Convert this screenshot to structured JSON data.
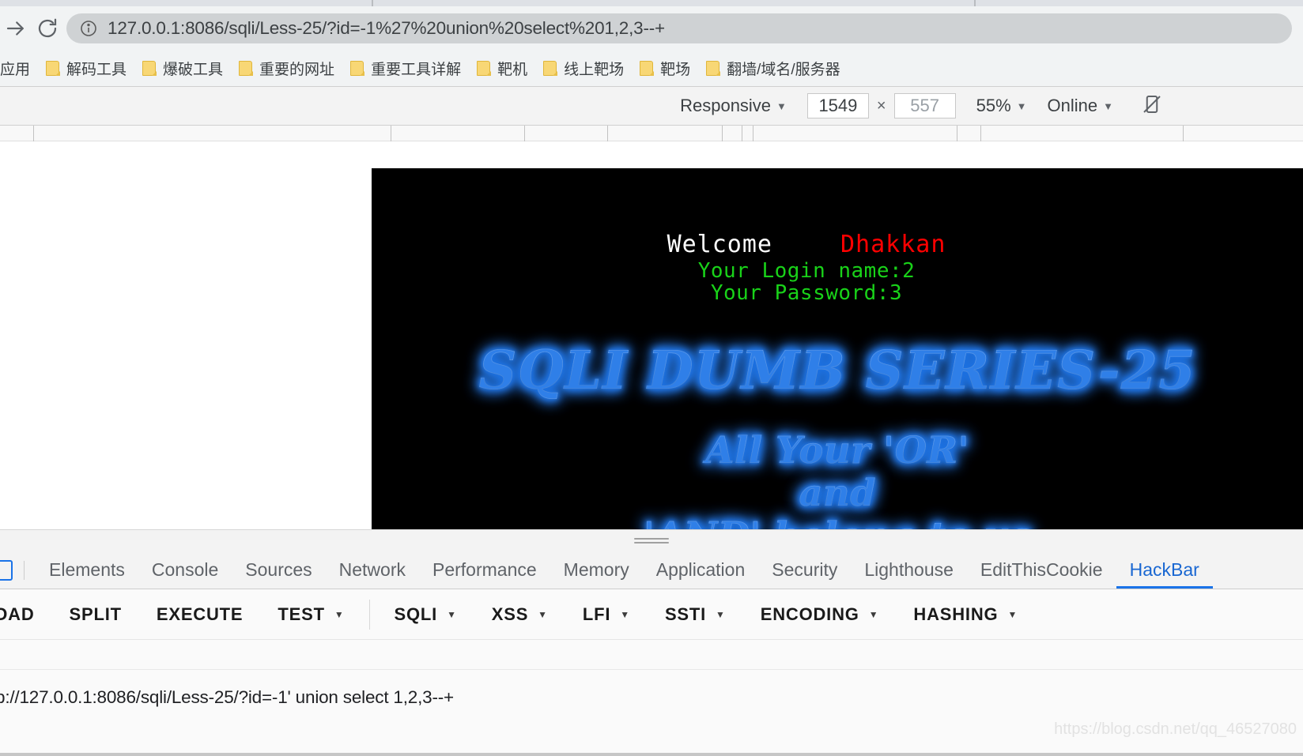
{
  "browser": {
    "nav": {
      "forward_icon": "arrow-right-icon",
      "reload_icon": "reload-icon"
    },
    "omnibox": {
      "info_icon": "info-circle-icon",
      "url": "127.0.0.1:8086/sqli/Less-25/?id=-1%27%20union%20select%201,2,3--+"
    },
    "bookmarks": [
      {
        "label": "应用",
        "icon": "apps-icon",
        "has_folder": false
      },
      {
        "label": "解码工具",
        "icon": "folder-icon",
        "has_folder": true
      },
      {
        "label": "爆破工具",
        "icon": "folder-icon",
        "has_folder": true
      },
      {
        "label": "重要的网址",
        "icon": "folder-icon",
        "has_folder": true
      },
      {
        "label": "重要工具详解",
        "icon": "folder-icon",
        "has_folder": true
      },
      {
        "label": "靶机",
        "icon": "folder-icon",
        "has_folder": true
      },
      {
        "label": "线上靶场",
        "icon": "folder-icon",
        "has_folder": true
      },
      {
        "label": "靶场",
        "icon": "folder-icon",
        "has_folder": true
      },
      {
        "label": "翻墙/域名/服务器",
        "icon": "folder-icon",
        "has_folder": true
      }
    ]
  },
  "device_toolbar": {
    "device": "Responsive",
    "width": "1549",
    "separator": "×",
    "height": "557",
    "zoom": "55%",
    "throttling": "Online",
    "rotate_icon": "rotate-device-icon"
  },
  "page": {
    "welcome": "Welcome",
    "user": "Dhakkan",
    "login_name": "Your Login name:2",
    "password": "Your Password:3",
    "title": "SQLI DUMB SERIES-25",
    "tagline_1": "All Your 'OR'",
    "tagline_2": "and",
    "tagline_3": "'AND' belong to us",
    "colors": {
      "welcome": "#ffffff",
      "user": "#ff0000",
      "green": "#19d219",
      "glow": "#1a6fe0",
      "background": "#000000"
    }
  },
  "devtools": {
    "inspect_icon": "inspect-element-icon",
    "tabs": [
      {
        "label": "Elements",
        "active": false
      },
      {
        "label": "Console",
        "active": false
      },
      {
        "label": "Sources",
        "active": false
      },
      {
        "label": "Network",
        "active": false
      },
      {
        "label": "Performance",
        "active": false
      },
      {
        "label": "Memory",
        "active": false
      },
      {
        "label": "Application",
        "active": false
      },
      {
        "label": "Security",
        "active": false
      },
      {
        "label": "Lighthouse",
        "active": false
      },
      {
        "label": "EditThisCookie",
        "active": false
      },
      {
        "label": "HackBar",
        "active": true
      }
    ]
  },
  "hackbar": {
    "buttons": [
      {
        "label": "LOAD",
        "dropdown": false
      },
      {
        "label": "SPLIT",
        "dropdown": false
      },
      {
        "label": "EXECUTE",
        "dropdown": false
      },
      {
        "label": "TEST",
        "dropdown": true
      },
      {
        "label": "SQLI",
        "dropdown": true
      },
      {
        "label": "XSS",
        "dropdown": true
      },
      {
        "label": "LFI",
        "dropdown": true
      },
      {
        "label": "SSTI",
        "dropdown": true
      },
      {
        "label": "ENCODING",
        "dropdown": true
      },
      {
        "label": "HASHING",
        "dropdown": true
      }
    ],
    "url_value": "p://127.0.0.1:8086/sqli/Less-25/?id=-1' union select 1,2,3--+"
  },
  "watermark": "https://blog.csdn.net/qq_46527080"
}
